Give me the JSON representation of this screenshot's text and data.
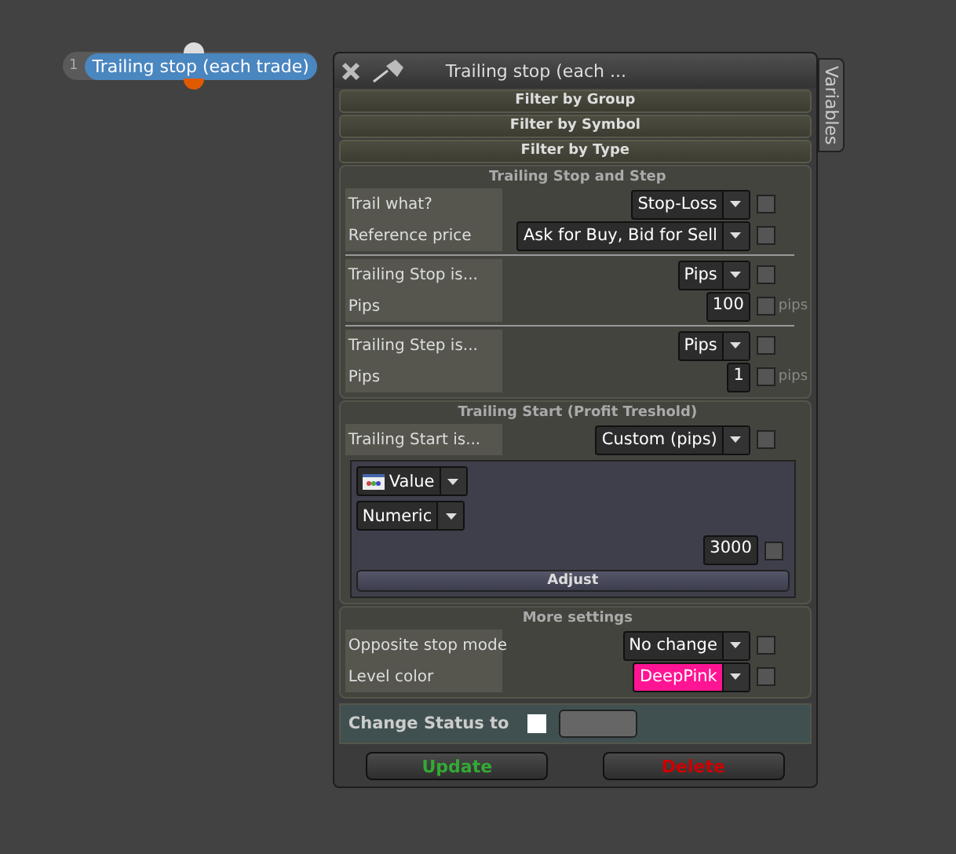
{
  "node": {
    "index": "1",
    "label": "Trailing stop (each trade)"
  },
  "panel": {
    "title": "Trailing stop (each ...",
    "side_tab": "Variables"
  },
  "filters": [
    "Filter by Group",
    "Filter by Symbol",
    "Filter by Type"
  ],
  "trailing": {
    "title": "Trailing Stop and Step",
    "groups": [
      [
        {
          "kind": "select",
          "label": "Trail what?",
          "value": "Stop-Loss",
          "checked": false
        },
        {
          "kind": "select",
          "label": "Reference price",
          "value": "Ask for Buy, Bid for Sell",
          "checked": false
        }
      ],
      [
        {
          "kind": "select",
          "label": "Trailing Stop is...",
          "value": "Pips",
          "checked": false
        },
        {
          "kind": "number",
          "label": "Pips",
          "value": "100",
          "unit": "pips",
          "checked": false
        }
      ],
      [
        {
          "kind": "select",
          "label": "Trailing Step is...",
          "value": "Pips",
          "checked": false
        },
        {
          "kind": "number",
          "label": "Pips",
          "value": "1",
          "unit": "pips",
          "checked": false
        }
      ]
    ]
  },
  "start": {
    "title": "Trailing Start (Profit Treshold)",
    "row": {
      "kind": "select",
      "label": "Trailing Start is...",
      "value": "Custom (pips)",
      "checked": false
    },
    "value_source": "Value",
    "value_type": "Numeric",
    "value": "3000",
    "checked": false,
    "button": "Adjust"
  },
  "more": {
    "title": "More settings",
    "rows": [
      {
        "kind": "select",
        "label": "Opposite stop mode",
        "value": "No change",
        "checked": false
      },
      {
        "kind": "color",
        "label": "Level color",
        "value": "DeepPink",
        "color": "#ff1493",
        "checked": false
      }
    ]
  },
  "status": {
    "label": "Change Status to",
    "checked": false
  },
  "buttons": [
    {
      "label": "Update",
      "kind": "confirm"
    },
    {
      "label": "Delete",
      "kind": "danger"
    }
  ]
}
